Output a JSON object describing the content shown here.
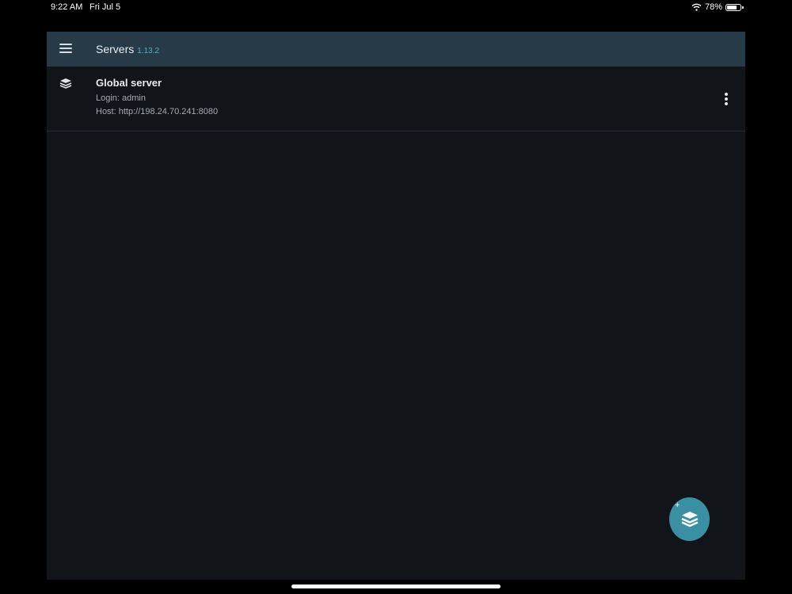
{
  "status_bar": {
    "time": "9:22 AM",
    "date": "Fri Jul 5",
    "battery": "78%",
    "battery_level": 0.78
  },
  "header": {
    "menu_icon": "hamburger-menu-icon",
    "title": "Servers",
    "version": "1.13.2"
  },
  "servers": [
    {
      "icon": "server-stack-icon",
      "name": "Global server",
      "login": "Login: admin",
      "host": "Host: http://198.24.70.241:8080",
      "menu_icon": "more-vertical-icon"
    }
  ],
  "fab": {
    "plus": "+",
    "icon": "add-server-icon"
  },
  "colors": {
    "header_bg": "#263a48",
    "content_bg": "#111418",
    "accent": "#4fb3c1",
    "fab_bg": "#3a8fa3"
  }
}
